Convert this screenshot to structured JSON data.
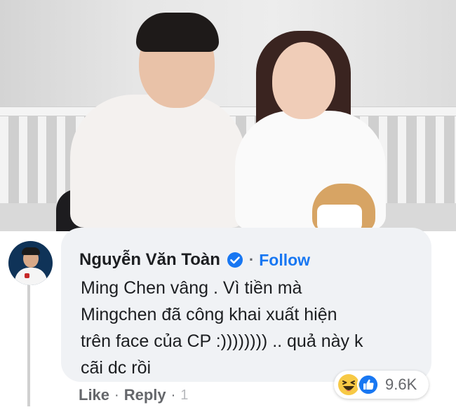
{
  "comment": {
    "author": "Nguyễn Văn Toàn",
    "separator": "·",
    "follow_label": "Follow",
    "text_lines": [
      "Ming Chen vâng . Vì tiền mà",
      "Mingchen đã công khai xuất hiện",
      "trên face của CP :)))))))) .. quả này k",
      "cãi dc rồi"
    ],
    "reactions": {
      "icons": [
        "haha-icon",
        "like-icon"
      ],
      "count": "9.6K"
    },
    "actions": {
      "like_label": "Like",
      "separator": "·",
      "reply_label": "Reply",
      "separator2": "·",
      "timestamp": "1"
    }
  },
  "colors": {
    "link_blue": "#1877f2",
    "bubble_bg": "#f0f2f5",
    "text_primary": "#1c1e21",
    "text_secondary": "#65676b",
    "haha_yellow": "#f7c945",
    "like_blue": "#1877f2"
  }
}
